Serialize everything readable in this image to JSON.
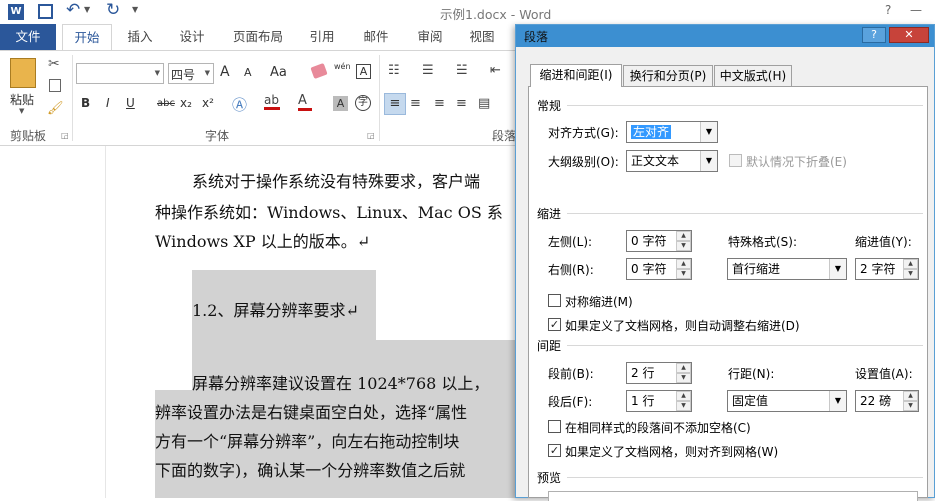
{
  "title_bar": {
    "title": "示例1.docx - Word",
    "help": "?",
    "minimize": "—"
  },
  "ribbon_tabs": [
    "文件",
    "开始",
    "插入",
    "设计",
    "页面布局",
    "引用",
    "邮件",
    "审阅",
    "视图"
  ],
  "ribbon": {
    "paste_label": "粘贴",
    "clipboard_group": "剪贴板",
    "font_group": "字体",
    "paragraph_group": "段落",
    "font_size": "四号",
    "bold": "B",
    "italic": "I",
    "underline": "U",
    "strike": "abc",
    "sub": "x₂",
    "sup": "x²",
    "grow": "A",
    "shrink": "A",
    "case": "Aa",
    "pinyin": "wén"
  },
  "document": {
    "lines": [
      "系统对于操作系统没有特殊要求，客户端",
      "种操作系统如：Windows、Linux、Mac OS 系",
      "Windows XP 以上的版本。↵",
      "1.2、屏幕分辨率要求↵",
      "屏幕分辨率建议设置在 1024*768 以上，",
      "辨率设置办法是右键桌面空白处，选择“属性",
      "方有一个“屏幕分辨率”，向左右拖动控制块",
      "下面的数字)，确认某一个分辨率数值之后就"
    ]
  },
  "dialog": {
    "title": "段落",
    "help": "?",
    "close": "✕",
    "tabs": [
      "缩进和间距(I)",
      "换行和分页(P)",
      "中文版式(H)"
    ],
    "general": {
      "section": "常规",
      "alignment_label": "对齐方式(G):",
      "alignment_value": "左对齐",
      "outline_label": "大纲级别(O):",
      "outline_value": "正文文本",
      "collapse_label": "默认情况下折叠(E)"
    },
    "indent": {
      "section": "缩进",
      "left_label": "左侧(L):",
      "left_value": "0 字符",
      "right_label": "右侧(R):",
      "right_value": "0 字符",
      "special_label": "特殊格式(S):",
      "special_value": "首行缩进",
      "by_label": "缩进值(Y):",
      "by_value": "2 字符",
      "mirror_label": "对称缩进(M)",
      "auto_label": "如果定义了文档网格，则自动调整右缩进(D)"
    },
    "spacing": {
      "section": "间距",
      "before_label": "段前(B):",
      "before_value": "2 行",
      "after_label": "段后(F):",
      "after_value": "1 行",
      "line_label": "行距(N):",
      "line_value": "固定值",
      "at_label": "设置值(A):",
      "at_value": "22 磅",
      "no_space_label": "在相同样式的段落间不添加空格(C)",
      "snap_label": "如果定义了文档网格，则对齐到网格(W)"
    },
    "preview": {
      "section": "预览"
    }
  }
}
